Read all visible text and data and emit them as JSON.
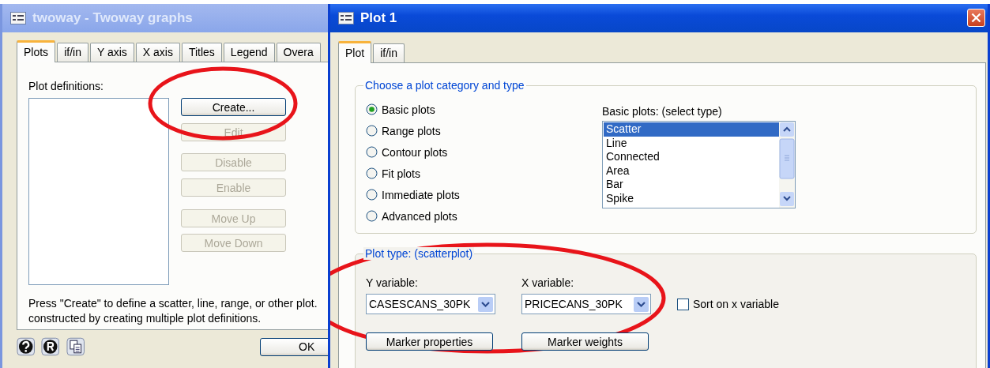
{
  "twoway_window": {
    "title": "twoway - Twoway graphs",
    "active": false,
    "tabs": [
      {
        "label": "Plots",
        "selected": true
      },
      {
        "label": "if/in",
        "selected": false
      },
      {
        "label": "Y axis",
        "selected": false
      },
      {
        "label": "X axis",
        "selected": false
      },
      {
        "label": "Titles",
        "selected": false
      },
      {
        "label": "Legend",
        "selected": false
      },
      {
        "label": "Overa",
        "selected": false
      }
    ],
    "plot_definitions_label": "Plot definitions:",
    "buttons": [
      {
        "label": "Create...",
        "disabled": false,
        "highlighted": true
      },
      {
        "label": "Edit",
        "disabled": true,
        "highlighted": false
      },
      {
        "label": "Disable",
        "disabled": true,
        "highlighted": false
      },
      {
        "label": "Enable",
        "disabled": true,
        "highlighted": false
      },
      {
        "label": "Move Up",
        "disabled": true,
        "highlighted": false
      },
      {
        "label": "Move Down",
        "disabled": true,
        "highlighted": false
      }
    ],
    "note_lines": [
      "Press \"Create\" to define a scatter, line, range, or other plot.",
      "constructed by creating multiple plot definitions."
    ],
    "ok_button": "OK"
  },
  "plot_window": {
    "title": "Plot 1",
    "active": true,
    "tabs": [
      {
        "label": "Plot",
        "selected": true
      },
      {
        "label": "if/in",
        "selected": false
      }
    ],
    "category_group": {
      "title": "Choose a plot category and type",
      "categories": [
        {
          "label": "Basic plots",
          "selected": true
        },
        {
          "label": "Range plots",
          "selected": false
        },
        {
          "label": "Contour plots",
          "selected": false
        },
        {
          "label": "Fit plots",
          "selected": false
        },
        {
          "label": "Immediate plots",
          "selected": false
        },
        {
          "label": "Advanced plots",
          "selected": false
        }
      ],
      "list_label": "Basic plots: (select type)",
      "types": [
        {
          "label": "Scatter",
          "selected": true
        },
        {
          "label": "Line",
          "selected": false
        },
        {
          "label": "Connected",
          "selected": false
        },
        {
          "label": "Area",
          "selected": false
        },
        {
          "label": "Bar",
          "selected": false
        },
        {
          "label": "Spike",
          "selected": false
        }
      ]
    },
    "plot_type_group": {
      "title": "Plot type: (scatterplot)",
      "highlighted": true,
      "y_variable": {
        "label": "Y variable:",
        "value": "CASESCANS_30PK"
      },
      "x_variable": {
        "label": "X variable:",
        "value": "PRICECANS_30PK"
      },
      "sort_on_x": {
        "label": "Sort on x variable",
        "checked": false
      },
      "buttons": [
        "Marker properties",
        "Marker weights"
      ]
    }
  }
}
